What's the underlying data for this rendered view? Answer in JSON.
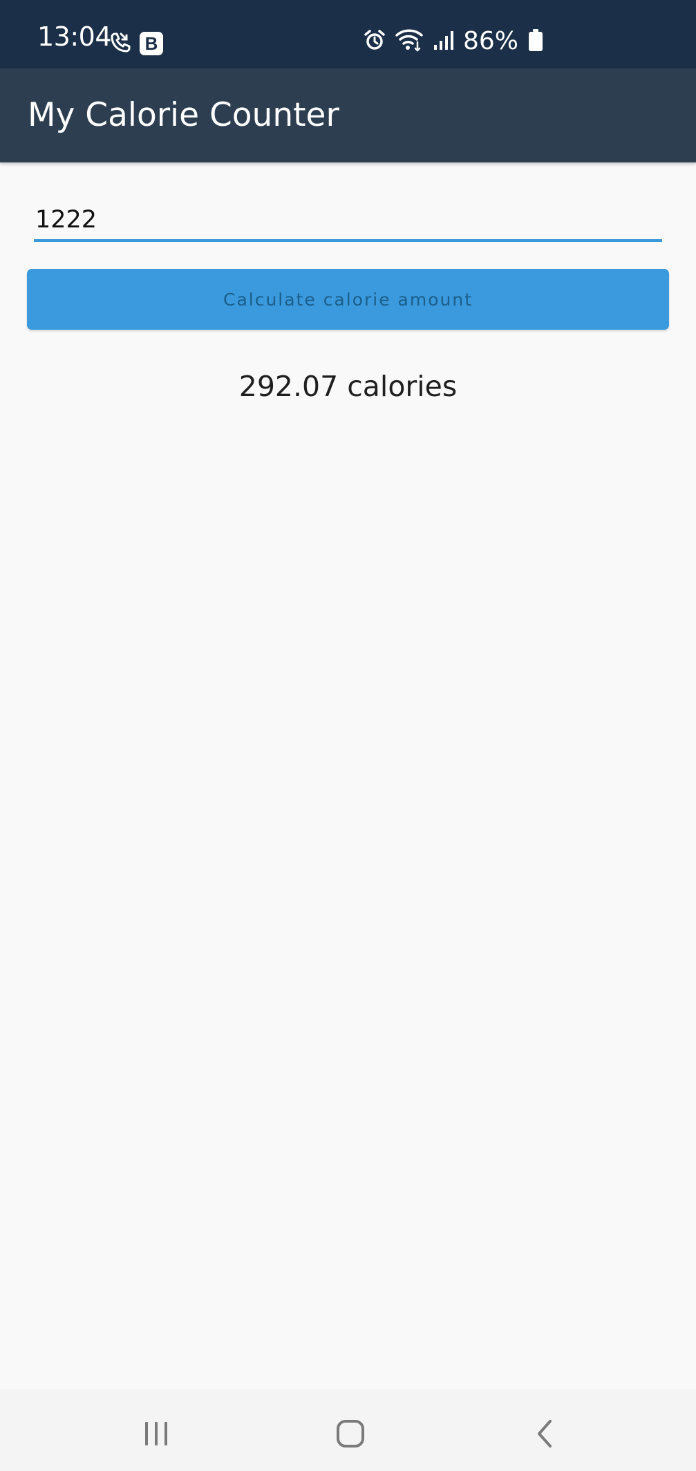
{
  "status_bar": {
    "time": "13:04",
    "battery": "86%",
    "icons": [
      "missed-call-icon",
      "b-app-icon",
      "alarm-icon",
      "wifi-icon",
      "signal-icon",
      "battery-icon"
    ],
    "b_badge": "B"
  },
  "app_bar": {
    "title": "My Calorie Counter"
  },
  "form": {
    "amount_value": "1222",
    "calculate_label": "Calculate calorie amount"
  },
  "result": {
    "text": "292.07 calories"
  },
  "nav_bar": {
    "icons": [
      "recent-apps-icon",
      "home-icon",
      "back-icon"
    ]
  },
  "colors": {
    "status_bar": "#1b2f48",
    "app_bar": "#2c3e50",
    "accent": "#3a9add",
    "background": "#f9f9f9"
  }
}
